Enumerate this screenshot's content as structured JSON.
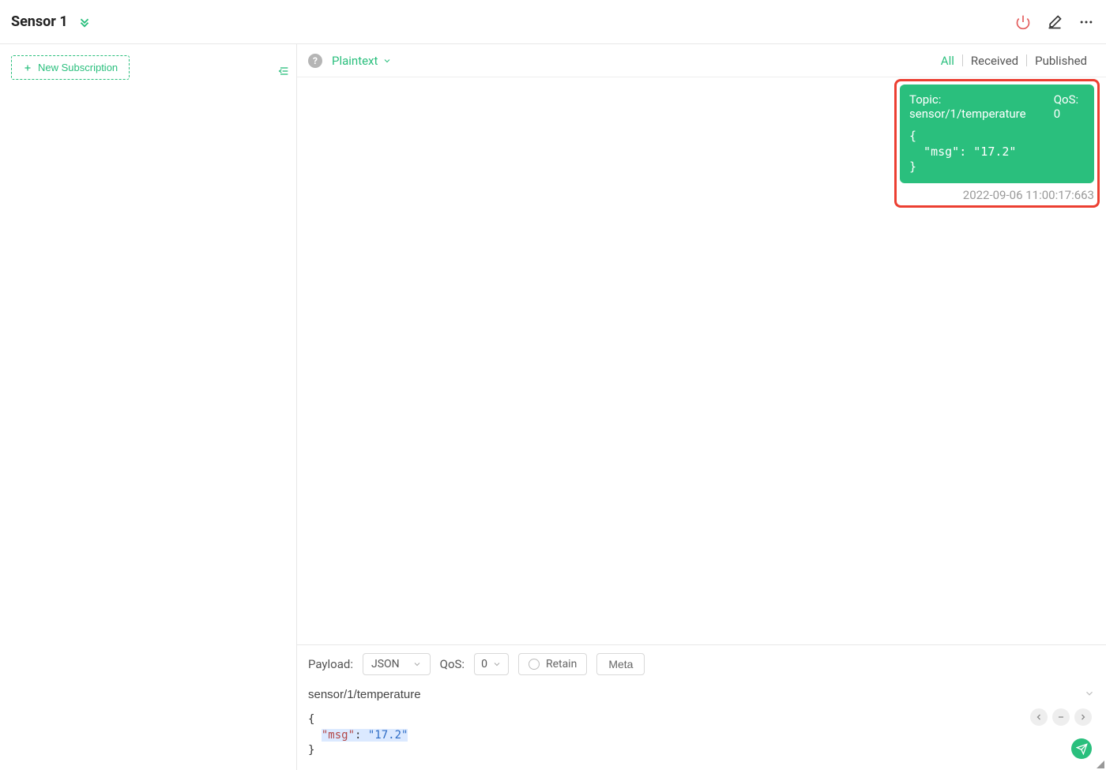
{
  "header": {
    "title": "Sensor 1"
  },
  "sidebar": {
    "new_subscription_label": "New Subscription"
  },
  "subbar": {
    "format_label": "Plaintext",
    "tabs": {
      "all": "All",
      "received": "Received",
      "published": "Published"
    }
  },
  "message": {
    "topic_label": "Topic: sensor/1/temperature",
    "qos_label": "QoS: 0",
    "payload": "{\n  \"msg\": \"17.2\"\n}",
    "timestamp": "2022-09-06 11:00:17:663"
  },
  "publish": {
    "payload_label": "Payload:",
    "payload_format": "JSON",
    "qos_label": "QoS:",
    "qos_value": "0",
    "retain_label": "Retain",
    "meta_label": "Meta",
    "topic": "sensor/1/temperature",
    "editor_tokens": {
      "open_brace": "{",
      "indent": "  ",
      "key_quoted": "\"msg\"",
      "colon_space": ": ",
      "val_quoted": "\"17.2\"",
      "close_brace": "}"
    }
  },
  "colors": {
    "accent": "#2abf7d",
    "highlight_border": "#ec3f31"
  }
}
